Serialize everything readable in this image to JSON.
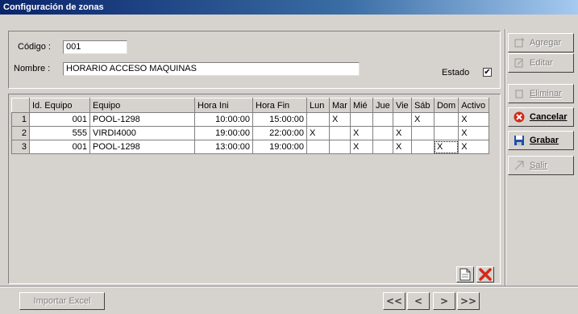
{
  "window": {
    "title": "Configuración de zonas"
  },
  "form": {
    "codigo_label": "Código :",
    "codigo_value": "001",
    "nombre_label": "Nombre :",
    "nombre_value": "HORARIO ACCESO MAQUINAS",
    "estado_label": "Estado",
    "estado_checked": "✔"
  },
  "grid": {
    "columns": [
      "Id. Equipo",
      "Equipo",
      "Hora Ini",
      "Hora Fin",
      "Lun",
      "Mar",
      "Mié",
      "Jue",
      "Vie",
      "Sáb",
      "Dom",
      "Activo"
    ],
    "rows": [
      {
        "n": "1",
        "id": "001",
        "equipo": "POOL-1298",
        "ini": "10:00:00",
        "fin": "15:00:00",
        "lun": "",
        "mar": "X",
        "mie": "",
        "jue": "",
        "vie": "",
        "sab": "X",
        "dom": "",
        "activo": "X"
      },
      {
        "n": "2",
        "id": "555",
        "equipo": "VIRDI4000",
        "ini": "19:00:00",
        "fin": "22:00:00",
        "lun": "X",
        "mar": "",
        "mie": "X",
        "jue": "",
        "vie": "X",
        "sab": "",
        "dom": "",
        "activo": "X"
      },
      {
        "n": "3",
        "id": "001",
        "equipo": "POOL-1298",
        "ini": "13:00:00",
        "fin": "19:00:00",
        "lun": "",
        "mar": "",
        "mie": "X",
        "jue": "",
        "vie": "X",
        "sab": "",
        "dom": "X",
        "activo": "X"
      }
    ]
  },
  "side_buttons": {
    "agregar": "Agregar",
    "editar": "Editar",
    "eliminar": "Eliminar",
    "cancelar": "Cancelar",
    "grabar": "Grabar",
    "salir": "Salir"
  },
  "bottom": {
    "importar": "Importar Excel",
    "first": "<<",
    "prev": "<",
    "next": ">",
    "last": ">>"
  },
  "icons": {
    "agregar": "add-icon",
    "editar": "edit-icon",
    "eliminar": "delete-icon",
    "cancelar": "cancel-icon",
    "grabar": "save-icon",
    "salir": "exit-icon",
    "new_row": "new-document-icon",
    "delete_row": "red-x-icon"
  },
  "colors": {
    "title_start": "#0a246a",
    "title_end": "#a6caf0",
    "cancel_red": "#d12a1a",
    "save_blue": "#1f4fa8"
  }
}
